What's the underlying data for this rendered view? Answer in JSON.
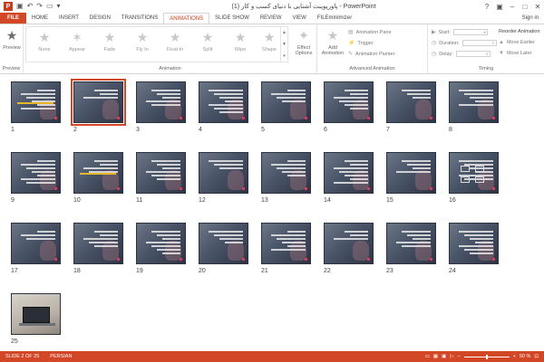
{
  "titlebar": {
    "logo": "P",
    "title": "پاورپوینت آشنایی با دنیای کسب و کار (1) - PowerPoint",
    "save_icon": "save-icon",
    "undo_icon": "undo-icon",
    "redo_icon": "redo-icon",
    "start_icon": "slideshow-start-icon"
  },
  "tabs": [
    {
      "label": "FILE"
    },
    {
      "label": "HOME"
    },
    {
      "label": "INSERT"
    },
    {
      "label": "DESIGN"
    },
    {
      "label": "TRANSITIONS"
    },
    {
      "label": "ANIMATIONS"
    },
    {
      "label": "SLIDE SHOW"
    },
    {
      "label": "REVIEW"
    },
    {
      "label": "VIEW"
    },
    {
      "label": "FILEminimizer"
    }
  ],
  "signin": "Sign in",
  "ribbon": {
    "preview": {
      "button": "Preview",
      "group": "Preview"
    },
    "animation_group": "Animation",
    "gallery": [
      {
        "label": "None"
      },
      {
        "label": "Appear"
      },
      {
        "label": "Fade"
      },
      {
        "label": "Fly In"
      },
      {
        "label": "Float In"
      },
      {
        "label": "Split"
      },
      {
        "label": "Wipe"
      },
      {
        "label": "Shape"
      }
    ],
    "effect_options": "Effect Options",
    "add_animation": "Add Animation",
    "advanced_group": "Advanced Animation",
    "animation_pane": "Animation Pane",
    "trigger": "Trigger",
    "animation_painter": "Animation Painter",
    "timing_group": "Timing",
    "start_label": "Start:",
    "duration_label": "Duration:",
    "delay_label": "Delay:",
    "reorder": "Reorder Animation",
    "move_earlier": "Move Earlier",
    "move_later": "Move Later"
  },
  "slides": {
    "selected": 2,
    "numbers": [
      "1",
      "2",
      "3",
      "4",
      "5",
      "6",
      "7",
      "8",
      "9",
      "10",
      "11",
      "12",
      "13",
      "14",
      "15",
      "16",
      "17",
      "18",
      "19",
      "20",
      "21",
      "22",
      "23",
      "24",
      "25"
    ]
  },
  "statusbar": {
    "slide_info": "SLIDE 2 OF 25",
    "language": "PERSIAN",
    "zoom": "50 %",
    "zoom_fraction": 0.5
  },
  "colors": {
    "accent": "#D24726",
    "status_bar": "#D24726",
    "selection": "#D24726"
  }
}
